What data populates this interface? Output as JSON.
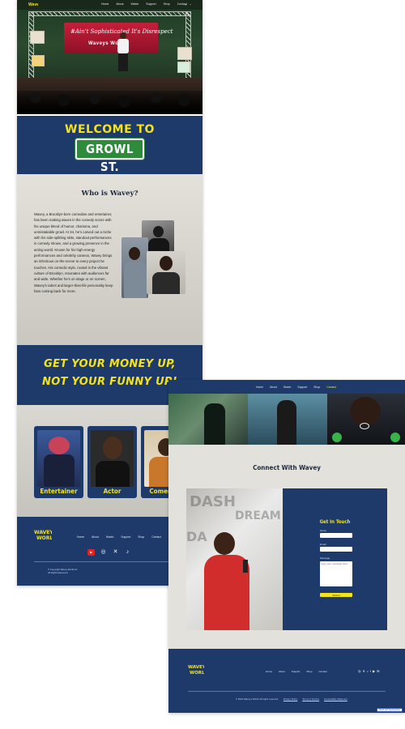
{
  "nav": {
    "logo": "Wavey's World",
    "links": [
      "Home",
      "About",
      "Watch",
      "Support",
      "Shop",
      "Contact"
    ],
    "icons": [
      "search-icon",
      "user-icon"
    ]
  },
  "hero": {
    "banner_line1": "#Ain't Sophisticated It's Disrespect",
    "banner_line2": "Waveys World"
  },
  "welcome": {
    "title": "WELCOME TO",
    "sign": "GROWL ST."
  },
  "about": {
    "title": "Who is Wavey?",
    "text": "Wavey, a Brooklyn-born comedian and entertainer, has been making waves in the comedy scene with his unique blend of humor, charisma, and unmistakable growl. At 34, he's carved out a niche with his side-splitting skits, standout performances in comedy shows, and a growing presence in the acting world. Known for his high-energy performances and celebrity cameos, Wavey brings an infectious on-the-scene to every project he touches. His comedic style, rooted in the vibrant culture of Brooklyn, resonates with audiences far and wide. Whether he's on stage or on screen, Wavey's talent and larger-than-life personality keep fans coming back for more."
  },
  "slogan": {
    "line1": "GET YOUR MONEY UP,",
    "line2": "NOT YOUR FUNNY UP!"
  },
  "roles": [
    {
      "label": "Entertainer"
    },
    {
      "label": "Actor"
    },
    {
      "label": "Comedian"
    }
  ],
  "footer1": {
    "links": [
      "Home",
      "About",
      "Watch",
      "Support",
      "Shop",
      "Contact"
    ],
    "social": [
      "youtube-icon",
      "instagram-icon",
      "x-icon",
      "tiktok-icon"
    ],
    "copyright": "© Copyright Wavey World Inc.",
    "rights": "All Rights Reserved."
  },
  "page2": {
    "nav_links": [
      "Home",
      "About",
      "Watch",
      "Support",
      "Shop",
      "Contact"
    ],
    "active_link": "Contact",
    "connect_title": "Connect With Wavey",
    "form": {
      "title": "Get In Touch",
      "name_label": "Name",
      "email_label": "Email",
      "message_label": "Message",
      "message_placeholder": "Type your message here...",
      "submit": "Submit"
    },
    "footer": {
      "links": [
        "Home",
        "About",
        "Support",
        "Shop",
        "Contact"
      ],
      "social": [
        "instagram-icon",
        "x-icon",
        "tiktok-icon",
        "facebook-icon",
        "youtube-icon",
        "email-icon"
      ],
      "copyright": "© 2024 Wavey's World. All rights reserved.",
      "privacy": "Privacy Policy",
      "terms": "Terms of Service",
      "accessibility": "Accessibility Statement",
      "badge": "Made with Squarespace"
    }
  },
  "colors": {
    "navy": "#1d3a6b",
    "yellow": "#f4e21b",
    "street_green": "#2e8b3c",
    "stone": "#d9d8d2"
  }
}
